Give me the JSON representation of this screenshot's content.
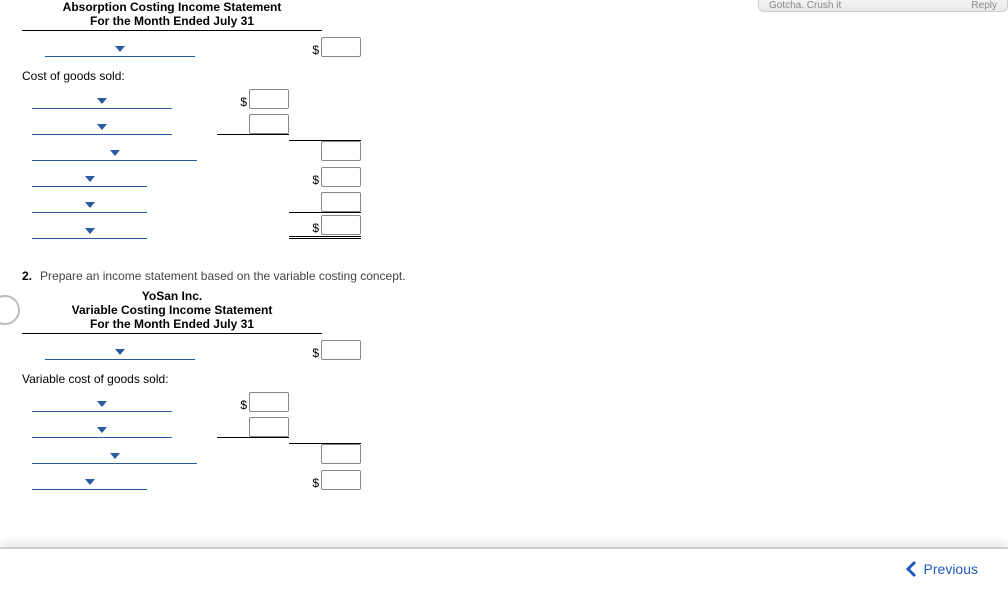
{
  "header": {
    "left_text": "Gotcha. Crush it",
    "right_text": "Reply"
  },
  "section1": {
    "title1": "Absorption Costing Income Statement",
    "title2": "For the Month Ended July 31",
    "cogs_label": "Cost of goods sold:"
  },
  "section2": {
    "intro_num": "2.",
    "intro_text": "Prepare an income statement based on the variable costing concept.",
    "company": "YoSan Inc.",
    "title1": "Variable Costing Income Statement",
    "title2": "For the Month Ended July 31",
    "vcogs_label": "Variable cost of goods sold:"
  },
  "currency": "$",
  "footer": {
    "prev": "Previous"
  }
}
